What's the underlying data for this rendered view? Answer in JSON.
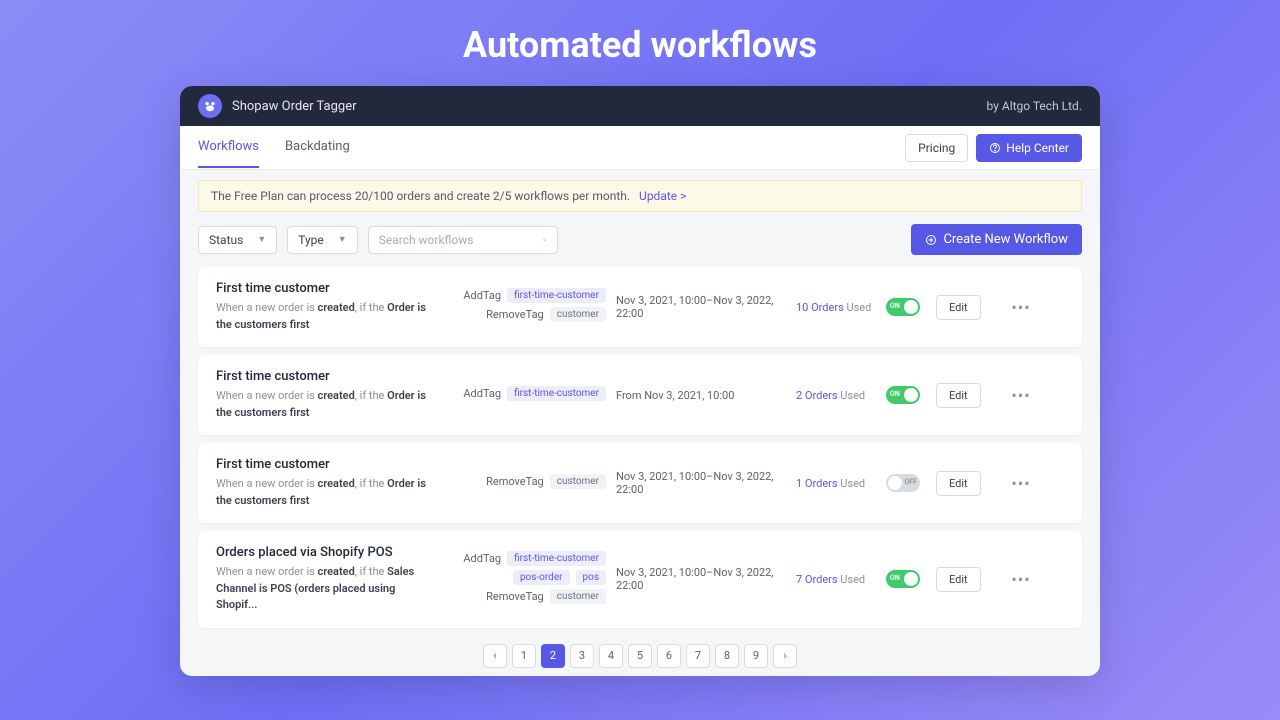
{
  "page_title": "Automated workflows",
  "header": {
    "app_name": "Shopaw Order Tagger",
    "vendor": "by Altgo Tech Ltd."
  },
  "tabs": {
    "workflows": "Workflows",
    "backdating": "Backdating",
    "pricing": "Pricing",
    "help": "Help Center"
  },
  "notice": {
    "text": "The Free Plan can process 20/100 orders and create 2/5 workflows per month.",
    "link": "Update >"
  },
  "filters": {
    "status": "Status",
    "type": "Type",
    "search_placeholder": "Search workflows",
    "create": "Create New Workflow"
  },
  "rows": [
    {
      "title": "First time customer",
      "desc_pre": "When a new order is ",
      "desc_b1": "created",
      "desc_mid": ", if the ",
      "desc_b2": "Order is the customers first",
      "tags": [
        {
          "action": "AddTag",
          "chips": [
            {
              "t": "first-time-customer",
              "k": "accent"
            }
          ]
        },
        {
          "action": "RemoveTag",
          "chips": [
            {
              "t": "customer",
              "k": "plain"
            }
          ]
        }
      ],
      "date": "Nov 3, 2021, 10:00–Nov 3, 2022, 22:00",
      "usage_num": "10",
      "usage_orders": "Orders",
      "usage_used": "Used",
      "toggle": "on",
      "toggle_text": "ON",
      "edit": "Edit"
    },
    {
      "title": "First time customer",
      "desc_pre": "When a new order is ",
      "desc_b1": "created",
      "desc_mid": ", if the ",
      "desc_b2": "Order is the customers first",
      "tags": [
        {
          "action": "AddTag",
          "chips": [
            {
              "t": "first-time-customer",
              "k": "accent"
            }
          ]
        }
      ],
      "date": "From Nov 3, 2021, 10:00",
      "usage_num": "2",
      "usage_orders": "Orders",
      "usage_used": "Used",
      "toggle": "on",
      "toggle_text": "ON",
      "edit": "Edit"
    },
    {
      "title": "First time customer",
      "desc_pre": "When a new order is ",
      "desc_b1": "created",
      "desc_mid": ", if the ",
      "desc_b2": "Order is the customers first",
      "tags": [
        {
          "action": "RemoveTag",
          "chips": [
            {
              "t": "customer",
              "k": "plain"
            }
          ]
        }
      ],
      "date": "Nov 3, 2021, 10:00–Nov 3, 2022, 22:00",
      "usage_num": "1",
      "usage_orders": "Orders",
      "usage_used": "Used",
      "toggle": "off",
      "toggle_text": "OFF",
      "edit": "Edit"
    },
    {
      "title": "Orders placed via Shopify POS",
      "desc_pre": "When a new order is ",
      "desc_b1": "created",
      "desc_mid": ", if the ",
      "desc_b2": "Sales Channel is POS (orders placed using Shopif...",
      "tags": [
        {
          "action": "AddTag",
          "chips": [
            {
              "t": "first-time-customer",
              "k": "accent"
            }
          ]
        },
        {
          "action": "",
          "chips": [
            {
              "t": "pos-order",
              "k": "accent"
            },
            {
              "t": "pos",
              "k": "accent"
            }
          ]
        },
        {
          "action": "RemoveTag",
          "chips": [
            {
              "t": "customer",
              "k": "plain"
            }
          ]
        }
      ],
      "date": "Nov 3, 2021, 10:00–Nov 3, 2022, 22:00",
      "usage_num": "7",
      "usage_orders": "Orders",
      "usage_used": "Used",
      "toggle": "on",
      "toggle_text": "ON",
      "edit": "Edit"
    }
  ],
  "pagination": {
    "pages": [
      "1",
      "2",
      "3",
      "4",
      "5",
      "6",
      "7",
      "8",
      "9"
    ],
    "active": "2",
    "prev": "‹",
    "next": "›"
  }
}
